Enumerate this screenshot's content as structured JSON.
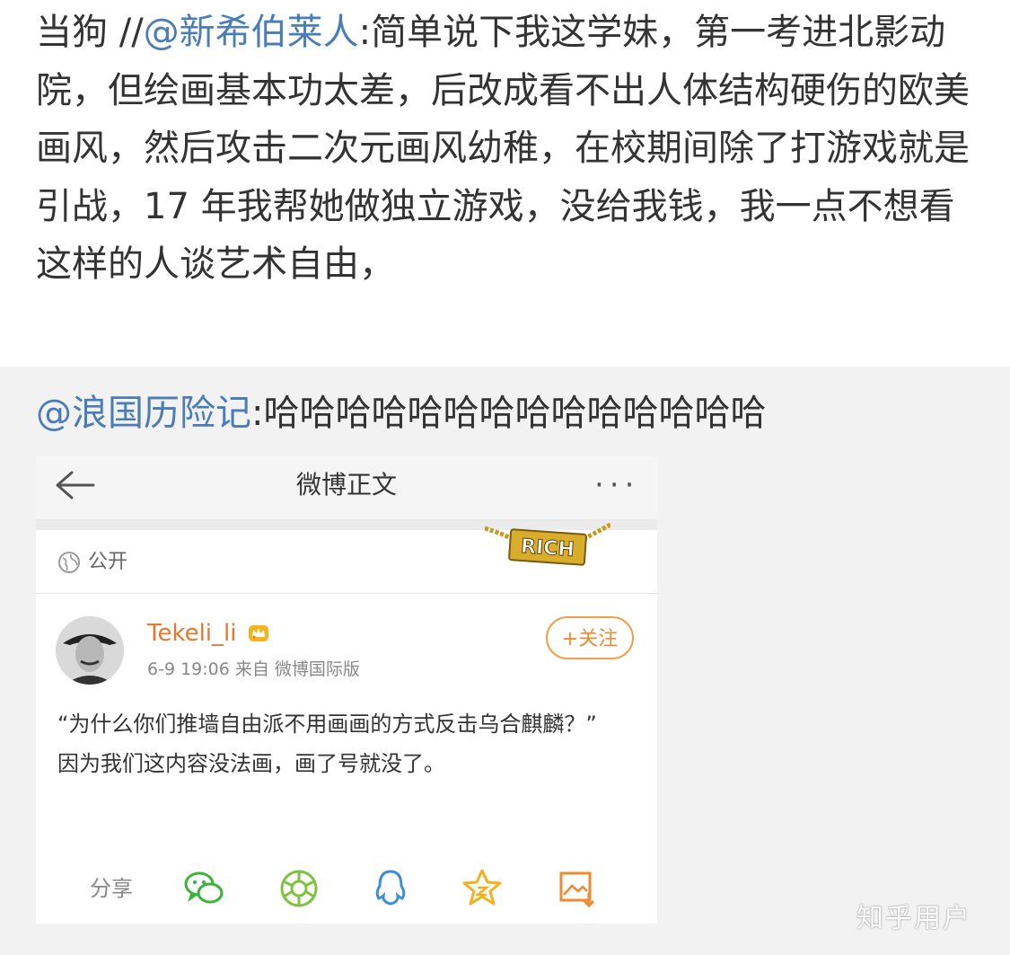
{
  "main_post": {
    "prefix": "当狗 //",
    "mention": "@新希伯莱人",
    "body": ":简单说下我这学妹，第一考进北影动院，但绘画基本功太差，后改成看不出人体结构硬伤的欧美画风，然后攻击二次元画风幼稚，在校期间除了打游戏就是引战，17 年我帮她做独立游戏，没给我钱，我一点不想看这样的人谈艺术自由，"
  },
  "repost": {
    "mention": "@浪国历险记",
    "text": ":哈哈哈哈哈哈哈哈哈哈哈哈哈哈"
  },
  "embedded": {
    "header_title": "微博正文",
    "more": "···",
    "visibility": "公开",
    "badge_text": "RICH",
    "username": "Tekeli_li",
    "meta": "6-9 19:06  来自 微博国际版",
    "follow_label": "+关注",
    "body_line1": "“为什么你们推墙自由派不用画画的方式反击乌合麒麟？”",
    "body_line2": "因为我们这内容没法画，画了号就没了。",
    "share_label": "分享",
    "share_icons": [
      "wechat-icon",
      "moments-icon",
      "qq-icon",
      "qzone-icon",
      "save-image-icon"
    ]
  },
  "watermark": "知乎用户",
  "colors": {
    "mention": "#4a7cb7",
    "username": "#e8762e",
    "follow": "#f08a2e",
    "wechat": "#3bb33b",
    "moments": "#7fc241",
    "qq": "#3b8fd9",
    "qzone": "#f2b11d",
    "save": "#f08a2e"
  }
}
